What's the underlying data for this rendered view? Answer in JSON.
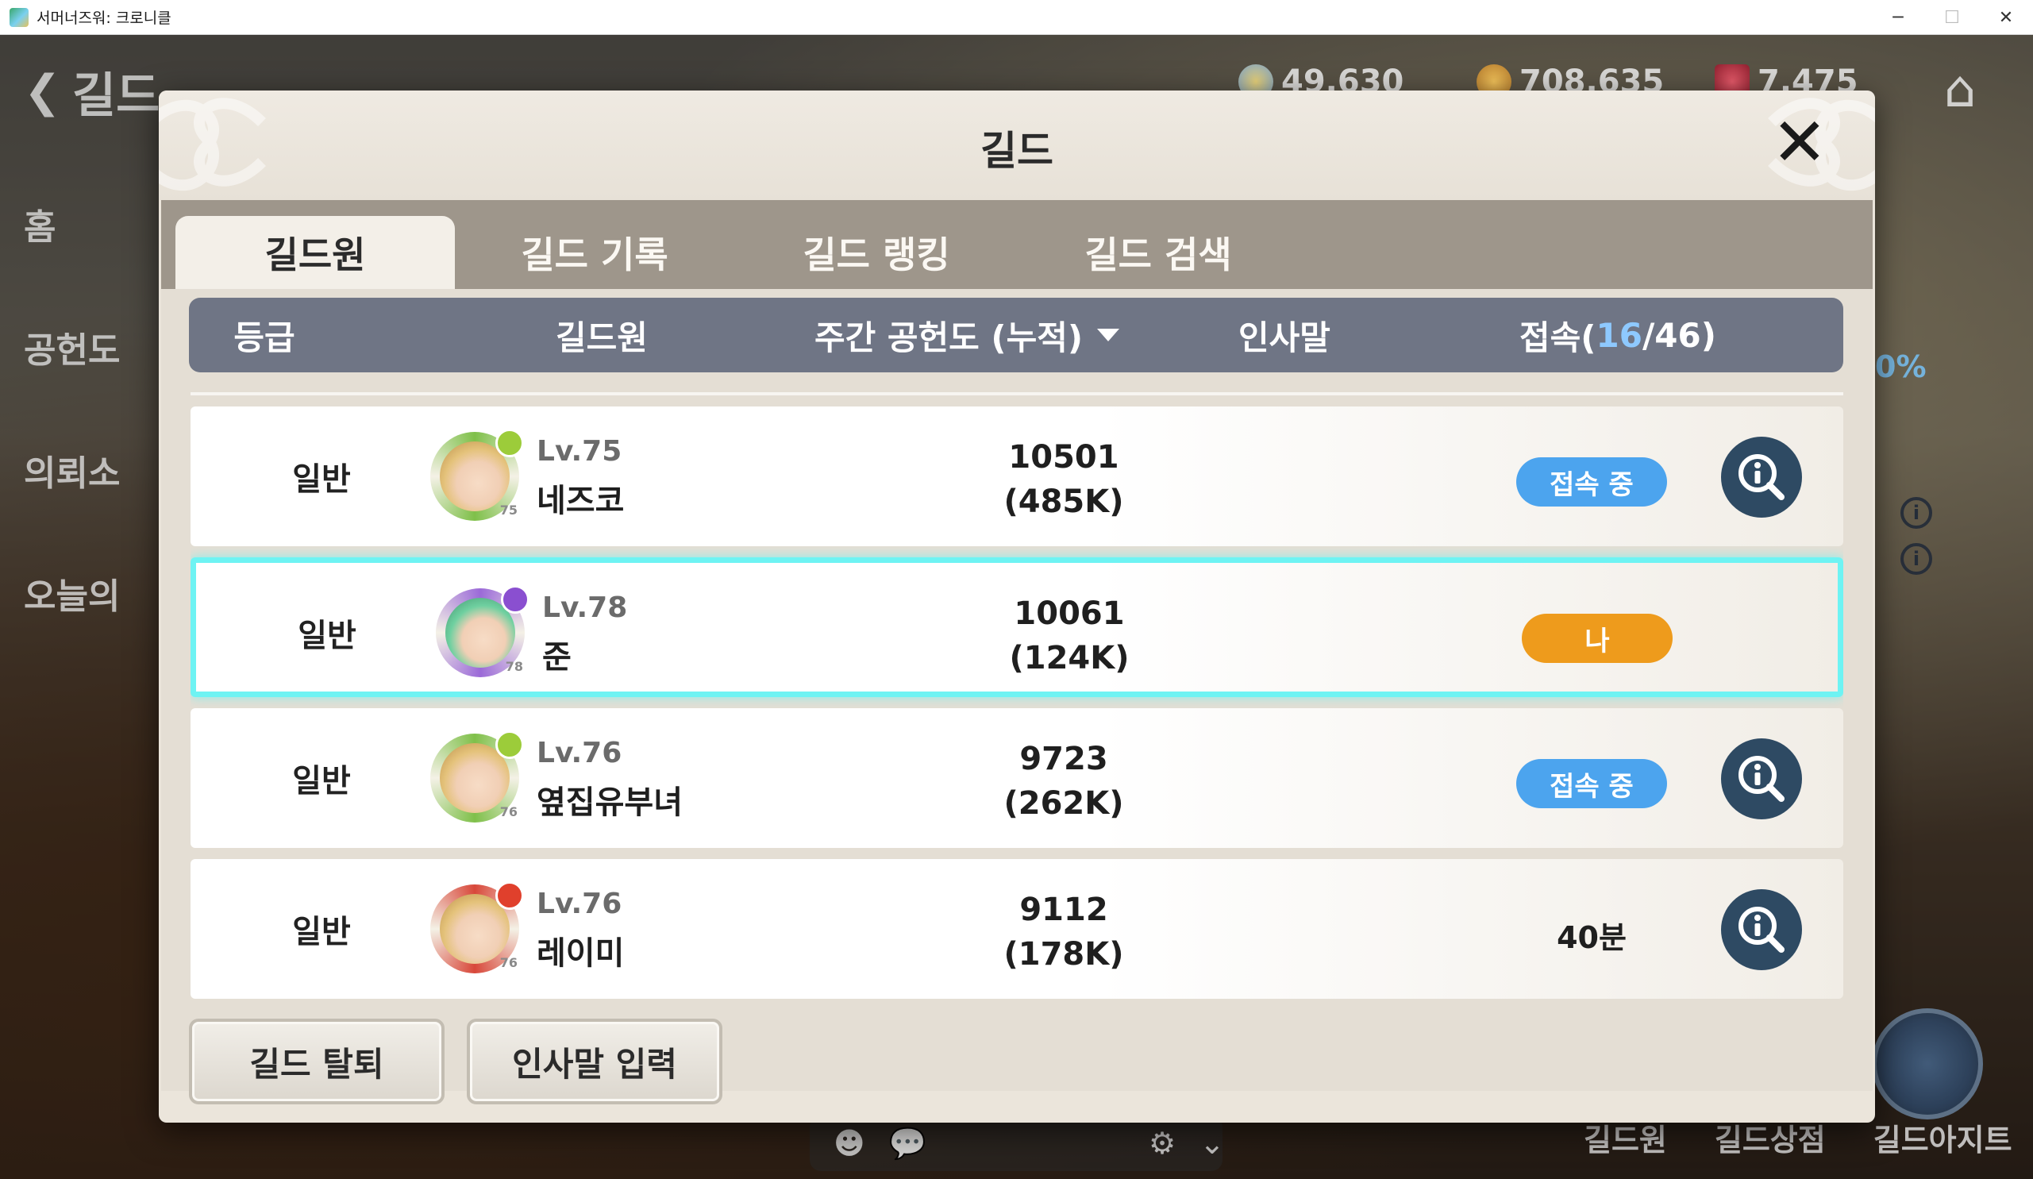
{
  "window": {
    "title": "서머너즈워: 크로니클",
    "minimize": "─",
    "maximize": "☐",
    "close": "✕"
  },
  "background_hud": {
    "back_label": "길드",
    "side_menu": [
      "홈",
      "공헌도",
      "의뢰소",
      "오늘의"
    ],
    "currencies": [
      "49,630",
      "708,635",
      "7,475"
    ],
    "percent": "0%",
    "bottom_nav": [
      "길드원",
      "길드상점",
      "길드아지트"
    ]
  },
  "modal": {
    "title": "길드",
    "close_glyph": "✕",
    "tabs": [
      {
        "label": "길드원",
        "active": true
      },
      {
        "label": "길드 기록",
        "active": false
      },
      {
        "label": "길드 랭킹",
        "active": false
      },
      {
        "label": "길드 검색",
        "active": false
      }
    ],
    "columns": {
      "grade": "등급",
      "member": "길드원",
      "contribution": "주간 공헌도 (누적)",
      "greeting": "인사말",
      "online_prefix": "접속(",
      "online_count": "16",
      "online_suffix": "/46)"
    },
    "members": [
      {
        "grade": "일반",
        "level": "Lv.75",
        "name": "네즈코",
        "weekly": "10501",
        "total": "(485K)",
        "status": "접속 중",
        "status_type": "online",
        "element_color": "#9ccc3a",
        "ring_color": "#7fc04a",
        "avatar_level": "75"
      },
      {
        "grade": "일반",
        "level": "Lv.78",
        "name": "준",
        "weekly": "10061",
        "total": "(124K)",
        "status": "나",
        "status_type": "me",
        "element_color": "#8a4fd0",
        "ring_color": "#9b6ad8",
        "avatar_level": "78"
      },
      {
        "grade": "일반",
        "level": "Lv.76",
        "name": "옆집유부녀",
        "weekly": "9723",
        "total": "(262K)",
        "status": "접속 중",
        "status_type": "online",
        "element_color": "#9ccc3a",
        "ring_color": "#7fc04a",
        "avatar_level": "76"
      },
      {
        "grade": "일반",
        "level": "Lv.76",
        "name": "레이미",
        "weekly": "9112",
        "total": "(178K)",
        "status": "40분",
        "status_type": "offline",
        "element_color": "#e0402c",
        "ring_color": "#d8483a",
        "avatar_level": "76"
      }
    ],
    "actions": {
      "leave": "길드 탈퇴",
      "greeting_input": "인사말 입력"
    }
  },
  "colors": {
    "header_bar": "#6f7585",
    "online_pill": "#4ca4ee",
    "me_pill": "#ee9b1c",
    "me_highlight": "#6ef3f3",
    "detail_button": "#2e4a63"
  }
}
